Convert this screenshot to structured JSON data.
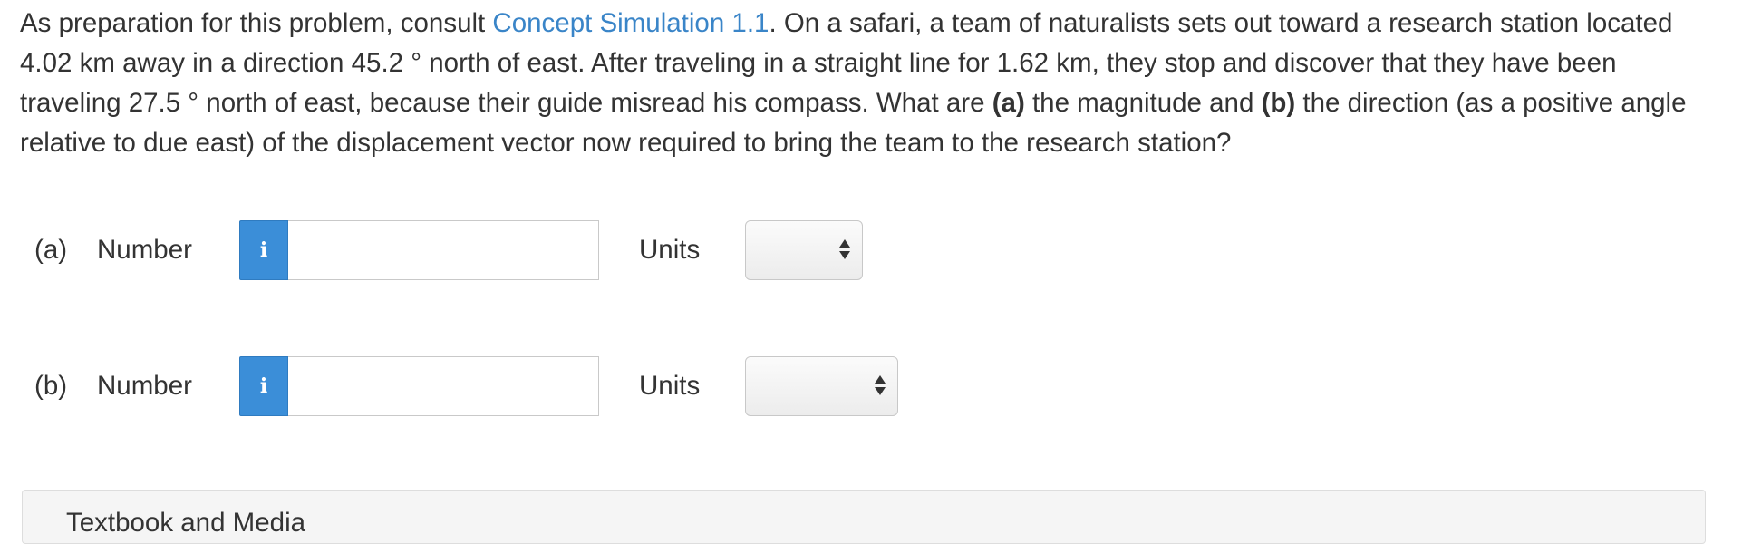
{
  "question": {
    "intro": "As preparation for this problem, consult ",
    "link_text": "Concept Simulation 1.1",
    "text_1": ". On a safari, a team of naturalists sets out toward a research station located 4.02 km away in a direction 45.2 ° north of east. After traveling in a straight line for 1.62 km, they stop and discover that they have been traveling 27.5 ° north of east, because their guide misread his compass. What are ",
    "bold_a": "(a)",
    "text_2": " the magnitude and ",
    "bold_b": "(b)",
    "text_3": " the direction (as a positive angle relative to due east) of the displacement vector now required to bring the team to the research station?"
  },
  "parts": [
    {
      "part_label": "(a)",
      "number_label": "Number",
      "info_icon": "info-icon",
      "number_value": "",
      "units_label": "Units",
      "units_selected": ""
    },
    {
      "part_label": "(b)",
      "number_label": "Number",
      "info_icon": "info-icon",
      "number_value": "",
      "units_label": "Units",
      "units_selected": ""
    }
  ],
  "media_panel": {
    "title": "Textbook and Media"
  },
  "colors": {
    "link": "#3a85c8",
    "info_button": "#3b8ed8",
    "text": "#333333"
  }
}
